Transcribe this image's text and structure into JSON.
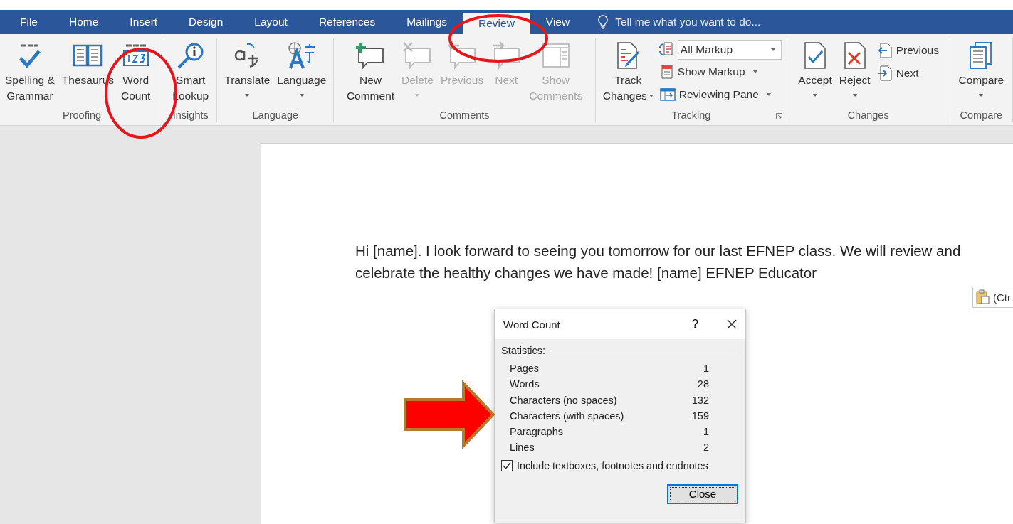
{
  "tabs": [
    {
      "label": "File",
      "selected": false
    },
    {
      "label": "Home",
      "selected": false
    },
    {
      "label": "Insert",
      "selected": false
    },
    {
      "label": "Design",
      "selected": false
    },
    {
      "label": "Layout",
      "selected": false
    },
    {
      "label": "References",
      "selected": false
    },
    {
      "label": "Mailings",
      "selected": false
    },
    {
      "label": "Review",
      "selected": true
    },
    {
      "label": "View",
      "selected": false
    }
  ],
  "tell_me": {
    "placeholder": "Tell me what you want to do..."
  },
  "ribbon": {
    "groups": [
      {
        "label": "Proofing",
        "launcher": false,
        "controls": [
          {
            "kind": "large",
            "lines": [
              "Spelling &",
              "Grammar"
            ],
            "dropdown": false,
            "disabled": false
          },
          {
            "kind": "large",
            "lines": [
              "Thesaurus"
            ],
            "dropdown": false,
            "disabled": false
          },
          {
            "kind": "large",
            "lines": [
              "Word",
              "Count"
            ],
            "dropdown": false,
            "disabled": false
          }
        ]
      },
      {
        "label": "Insights",
        "launcher": false,
        "controls": [
          {
            "kind": "large",
            "lines": [
              "Smart",
              "Lookup"
            ],
            "dropdown": false,
            "disabled": false
          }
        ]
      },
      {
        "label": "Language",
        "launcher": false,
        "controls": [
          {
            "kind": "large",
            "lines": [
              "Translate"
            ],
            "dropdown": true,
            "disabled": false
          },
          {
            "kind": "large",
            "lines": [
              "Language"
            ],
            "dropdown": true,
            "disabled": false
          }
        ]
      },
      {
        "label": "Comments",
        "launcher": false,
        "controls": [
          {
            "kind": "large",
            "lines": [
              "New",
              "Comment"
            ],
            "dropdown": false,
            "disabled": false
          },
          {
            "kind": "large",
            "lines": [
              "Delete"
            ],
            "dropdown": true,
            "disabled": true
          },
          {
            "kind": "large",
            "lines": [
              "Previous"
            ],
            "dropdown": false,
            "disabled": true
          },
          {
            "kind": "large",
            "lines": [
              "Next"
            ],
            "dropdown": false,
            "disabled": true
          },
          {
            "kind": "large",
            "lines": [
              "Show",
              "Comments"
            ],
            "dropdown": false,
            "disabled": true
          }
        ]
      },
      {
        "label": "Tracking",
        "launcher": true,
        "controls": [
          {
            "kind": "large",
            "lines": [
              "Track",
              "Changes"
            ],
            "dropdown": true,
            "disabled": false
          },
          {
            "kind": "stack",
            "items": [
              {
                "kind": "combo",
                "label": "All Markup",
                "dropdown": true
              },
              {
                "kind": "small",
                "label": "Show Markup",
                "dropdown": true
              },
              {
                "kind": "small",
                "label": "Reviewing Pane",
                "dropdown": true
              }
            ]
          }
        ]
      },
      {
        "label": "Changes",
        "launcher": false,
        "controls": [
          {
            "kind": "large",
            "lines": [
              "Accept"
            ],
            "dropdown": true,
            "disabled": false
          },
          {
            "kind": "large",
            "lines": [
              "Reject"
            ],
            "dropdown": true,
            "disabled": false
          },
          {
            "kind": "stack",
            "items": [
              {
                "kind": "small",
                "label": "Previous",
                "dropdown": false
              },
              {
                "kind": "small",
                "label": "Next",
                "dropdown": false
              }
            ]
          }
        ]
      },
      {
        "label": "Compare",
        "launcher": false,
        "controls": [
          {
            "kind": "large",
            "lines": [
              "Compare"
            ],
            "dropdown": true,
            "disabled": false
          }
        ]
      }
    ]
  },
  "document": {
    "paragraph": "Hi [name]. I look forward to seeing you tomorrow for our last EFNEP class. We will review and celebrate the healthy changes we have made! [name] EFNEP Educator",
    "paste_options": "(Ctr"
  },
  "dialog": {
    "title": "Word Count",
    "help": "?",
    "section": "Statistics:",
    "stats": [
      {
        "label": "Pages",
        "value": "1"
      },
      {
        "label": "Words",
        "value": "28"
      },
      {
        "label": "Characters (no spaces)",
        "value": "132"
      },
      {
        "label": "Characters (with spaces)",
        "value": "159"
      },
      {
        "label": "Paragraphs",
        "value": "1"
      },
      {
        "label": "Lines",
        "value": "2"
      }
    ],
    "checkbox": {
      "label": "Include textboxes, footnotes and endnotes",
      "checked": true
    },
    "button": "Close"
  }
}
